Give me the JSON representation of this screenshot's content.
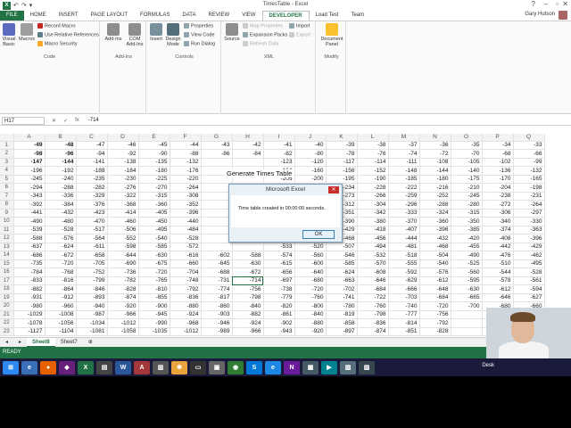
{
  "window": {
    "title": "TimesTable - Excel"
  },
  "quick_access": [
    "↶",
    "↷",
    "▾"
  ],
  "tabs": [
    "FILE",
    "HOME",
    "INSERT",
    "PAGE LAYOUT",
    "FORMULAS",
    "DATA",
    "REVIEW",
    "VIEW",
    "DEVELOPER",
    "Load Test",
    "Team"
  ],
  "active_tab": "DEVELOPER",
  "user": "Gary Hutson",
  "ribbon": {
    "code": {
      "label": "Code",
      "visual_basic": "Visual Basic",
      "macros": "Macros",
      "record_macro": "Record Macro",
      "relative": "Use Relative References",
      "security": "Macro Security"
    },
    "addins": {
      "label": "Add-Ins",
      "addins": "Add-Ins",
      "com": "COM Add-Ins"
    },
    "controls": {
      "label": "Controls",
      "insert": "Insert",
      "design": "Design Mode",
      "properties": "Properties",
      "view_code": "View Code",
      "run_dialog": "Run Dialog"
    },
    "xml": {
      "label": "XML",
      "source": "Source",
      "map_props": "Map Properties",
      "expansion": "Expansion Packs",
      "refresh": "Refresh Data",
      "import": "Import",
      "export": "Export"
    },
    "modify": {
      "label": "Modify",
      "doc_panel": "Document Panel"
    }
  },
  "formula_bar": {
    "name_box": "H17",
    "fx": "fx",
    "value": "-714"
  },
  "columns": [
    "A",
    "B",
    "C",
    "D",
    "E",
    "F",
    "G",
    "H",
    "I",
    "J",
    "K",
    "L",
    "M",
    "N",
    "O",
    "P",
    "Q"
  ],
  "rows": [
    [
      "1",
      "-49",
      "-48",
      "-47",
      "-46",
      "-45",
      "-44",
      "-43",
      "-42",
      "-41",
      "-40",
      "-39",
      "-38",
      "-37",
      "-36",
      "-35",
      "-34",
      "-33"
    ],
    [
      "2",
      "-98",
      "-96",
      "-94",
      "-92",
      "-90",
      "-88",
      "-86",
      "-84",
      "-82",
      "-80",
      "-78",
      "-76",
      "-74",
      "-72",
      "-70",
      "-68",
      "-66"
    ],
    [
      "3",
      "-147",
      "-144",
      "-141",
      "-138",
      "-135",
      "-132",
      "",
      "",
      "-123",
      "-120",
      "-117",
      "-114",
      "-111",
      "-108",
      "-105",
      "-102",
      "-99"
    ],
    [
      "4",
      "-196",
      "-192",
      "-188",
      "-184",
      "-180",
      "-176",
      "",
      "",
      "-164",
      "-160",
      "-156",
      "-152",
      "-148",
      "-144",
      "-140",
      "-136",
      "-132"
    ],
    [
      "5",
      "-245",
      "-240",
      "-235",
      "-230",
      "-225",
      "-220",
      "",
      "",
      "-205",
      "-200",
      "-195",
      "-190",
      "-185",
      "-180",
      "-175",
      "-170",
      "-165"
    ],
    [
      "6",
      "-294",
      "-288",
      "-282",
      "-276",
      "-270",
      "-264",
      "",
      "",
      "-246",
      "-240",
      "-234",
      "-228",
      "-222",
      "-216",
      "-210",
      "-204",
      "-198"
    ],
    [
      "7",
      "-343",
      "-336",
      "-329",
      "-322",
      "-315",
      "-308",
      "",
      "",
      "-287",
      "-280",
      "-273",
      "-266",
      "-259",
      "-252",
      "-245",
      "-238",
      "-231"
    ],
    [
      "8",
      "-392",
      "-384",
      "-376",
      "-368",
      "-360",
      "-352",
      "",
      "",
      "-328",
      "-320",
      "-312",
      "-304",
      "-296",
      "-288",
      "-280",
      "-272",
      "-264"
    ],
    [
      "9",
      "-441",
      "-432",
      "-423",
      "-414",
      "-405",
      "-396",
      "",
      "",
      "-369",
      "-360",
      "-351",
      "-342",
      "-333",
      "-324",
      "-315",
      "-306",
      "-297"
    ],
    [
      "10",
      "-490",
      "-480",
      "-470",
      "-460",
      "-450",
      "-440",
      "",
      "",
      "-410",
      "-400",
      "-390",
      "-380",
      "-370",
      "-360",
      "-350",
      "-340",
      "-330"
    ],
    [
      "11",
      "-539",
      "-528",
      "-517",
      "-506",
      "-495",
      "-484",
      "",
      "",
      "-451",
      "-440",
      "-429",
      "-418",
      "-407",
      "-396",
      "-385",
      "-374",
      "-363"
    ],
    [
      "12",
      "-588",
      "-576",
      "-564",
      "-552",
      "-540",
      "-528",
      "",
      "",
      "-492",
      "-480",
      "-468",
      "-456",
      "-444",
      "-432",
      "-420",
      "-408",
      "-396"
    ],
    [
      "13",
      "-637",
      "-624",
      "-611",
      "-598",
      "-585",
      "-572",
      "",
      "",
      "-533",
      "-520",
      "-507",
      "-494",
      "-481",
      "-468",
      "-455",
      "-442",
      "-429"
    ],
    [
      "14",
      "-686",
      "-672",
      "-658",
      "-644",
      "-630",
      "-616",
      "-602",
      "-588",
      "-574",
      "-560",
      "-546",
      "-532",
      "-518",
      "-504",
      "-490",
      "-476",
      "-462"
    ],
    [
      "15",
      "-735",
      "-720",
      "-705",
      "-690",
      "-675",
      "-660",
      "-645",
      "-630",
      "-615",
      "-600",
      "-585",
      "-570",
      "-555",
      "-540",
      "-525",
      "-510",
      "-495"
    ],
    [
      "16",
      "-784",
      "-768",
      "-752",
      "-736",
      "-720",
      "-704",
      "-688",
      "-672",
      "-656",
      "-640",
      "-624",
      "-608",
      "-592",
      "-576",
      "-560",
      "-544",
      "-528"
    ],
    [
      "17",
      "-833",
      "-816",
      "-799",
      "-782",
      "-765",
      "-748",
      "-731",
      "-714",
      "-697",
      "-680",
      "-663",
      "-646",
      "-629",
      "-612",
      "-595",
      "-578",
      "-561"
    ],
    [
      "18",
      "-882",
      "-864",
      "-846",
      "-828",
      "-810",
      "-792",
      "-774",
      "-756",
      "-738",
      "-720",
      "-702",
      "-684",
      "-666",
      "-648",
      "-630",
      "-612",
      "-594"
    ],
    [
      "19",
      "-931",
      "-912",
      "-893",
      "-874",
      "-855",
      "-836",
      "-817",
      "-798",
      "-779",
      "-760",
      "-741",
      "-722",
      "-703",
      "-684",
      "-665",
      "-646",
      "-627"
    ],
    [
      "20",
      "-980",
      "-960",
      "-940",
      "-920",
      "-900",
      "-880",
      "-860",
      "-840",
      "-820",
      "-800",
      "-780",
      "-760",
      "-740",
      "-720",
      "-700",
      "-680",
      "-660"
    ],
    [
      "21",
      "-1029",
      "-1008",
      "-987",
      "-966",
      "-945",
      "-924",
      "-903",
      "-882",
      "-861",
      "-840",
      "-819",
      "-798",
      "-777",
      "-756",
      "",
      "",
      ""
    ],
    [
      "22",
      "-1078",
      "-1056",
      "-1034",
      "-1012",
      "-990",
      "-968",
      "-946",
      "-924",
      "-902",
      "-880",
      "-858",
      "-836",
      "-814",
      "-792",
      "",
      "",
      ""
    ],
    [
      "23",
      "-1127",
      "-1104",
      "-1081",
      "-1058",
      "-1035",
      "-1012",
      "-989",
      "-966",
      "-943",
      "-920",
      "-897",
      "-874",
      "-851",
      "-828",
      "",
      "",
      ""
    ]
  ],
  "sheet_tabs": [
    "Sheet8",
    "Sheet7"
  ],
  "active_sheet": "Sheet8",
  "status": "READY",
  "floating_label": "Generate Times Table",
  "dialog": {
    "title": "Microsoft Excel",
    "message": "Time table created in 00:00:00 seconds.",
    "ok": "OK",
    "close": "✕"
  },
  "taskbar": {
    "desktop_label": "Desk"
  }
}
